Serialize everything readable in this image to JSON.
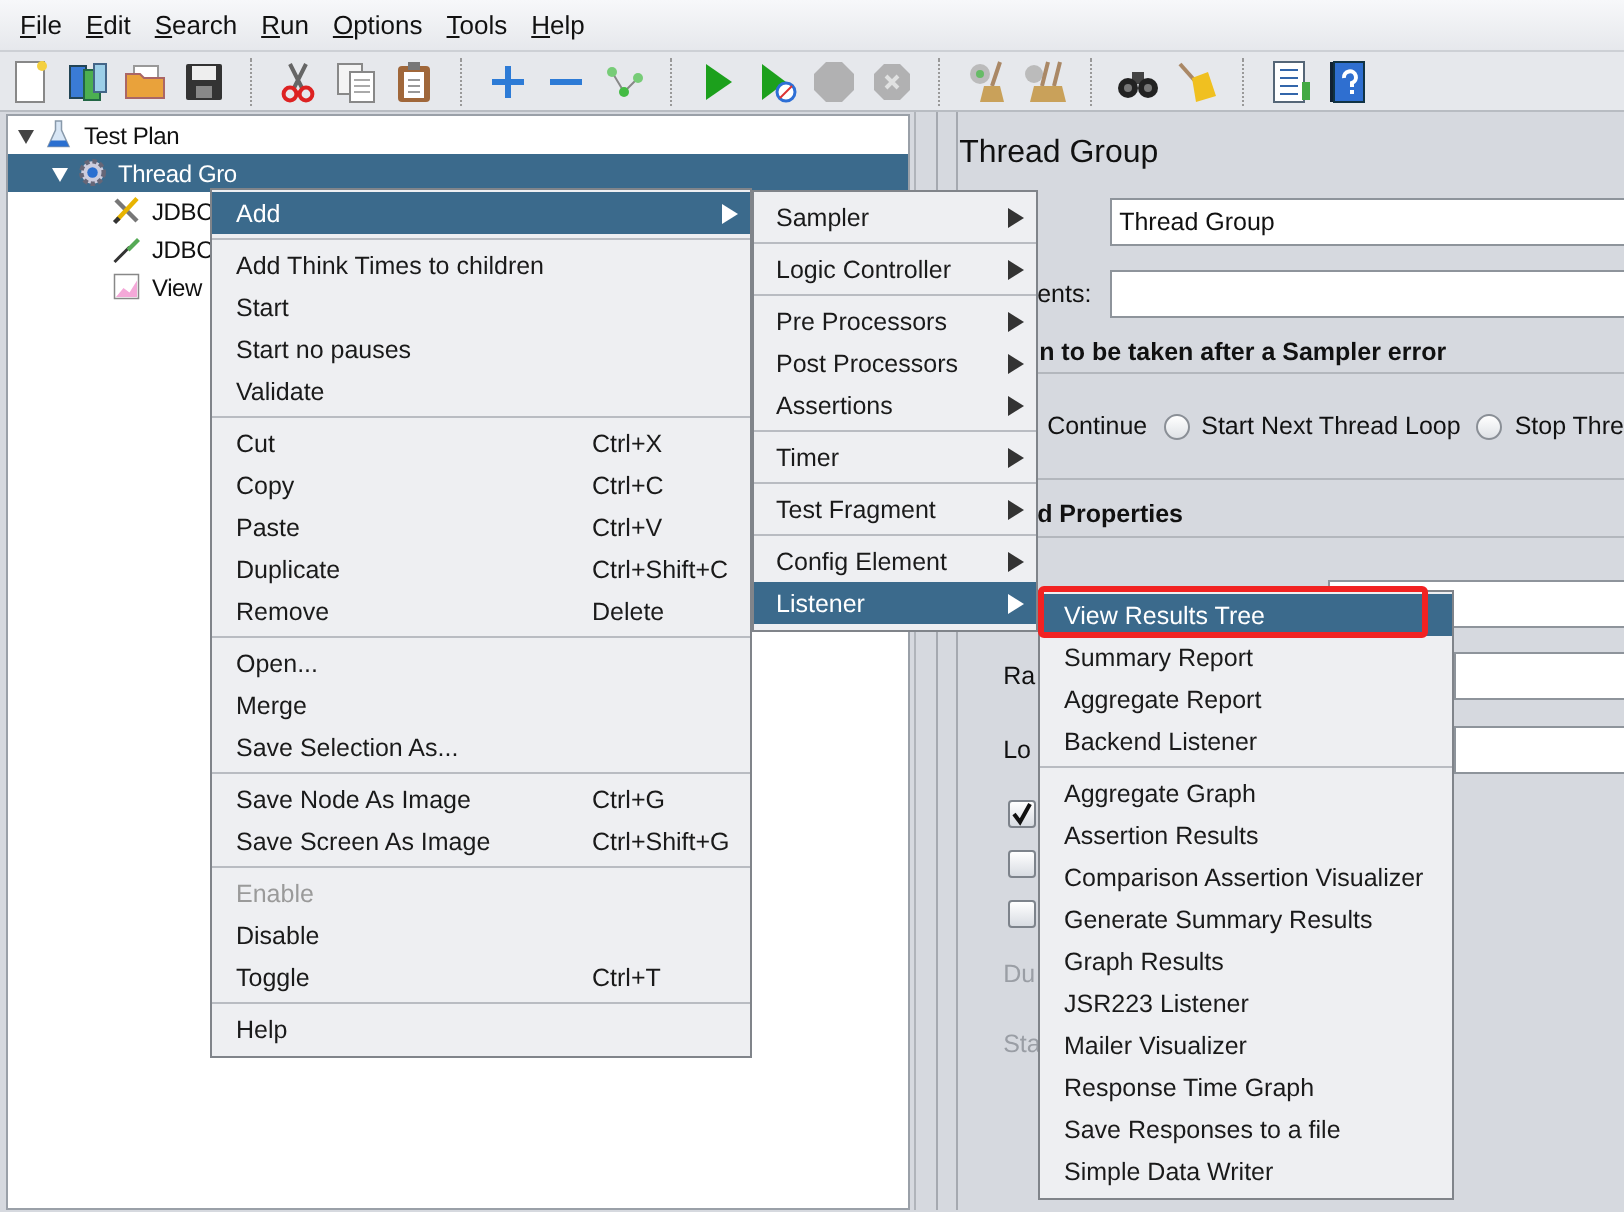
{
  "menu_bar": [
    "File",
    "Edit",
    "Search",
    "Run",
    "Options",
    "Tools",
    "Help"
  ],
  "toolbar": [
    {
      "kind": "new",
      "disabled": false
    },
    {
      "kind": "templates",
      "disabled": false
    },
    {
      "kind": "open",
      "disabled": false
    },
    {
      "kind": "save",
      "disabled": false
    },
    {
      "kind": "separator"
    },
    {
      "kind": "cut",
      "disabled": false
    },
    {
      "kind": "copy",
      "disabled": false
    },
    {
      "kind": "paste",
      "disabled": false
    },
    {
      "kind": "separator"
    },
    {
      "kind": "expand",
      "disabled": false
    },
    {
      "kind": "collapse",
      "disabled": false
    },
    {
      "kind": "toggle",
      "disabled": false
    },
    {
      "kind": "separator"
    },
    {
      "kind": "start",
      "disabled": false
    },
    {
      "kind": "start-no-pauses",
      "disabled": false
    },
    {
      "kind": "stop",
      "disabled": true
    },
    {
      "kind": "shutdown",
      "disabled": true
    },
    {
      "kind": "separator"
    },
    {
      "kind": "clear",
      "disabled": false
    },
    {
      "kind": "clear-all",
      "disabled": false
    },
    {
      "kind": "separator"
    },
    {
      "kind": "search",
      "disabled": false
    },
    {
      "kind": "reset-search",
      "disabled": false
    },
    {
      "kind": "separator"
    },
    {
      "kind": "function-helper",
      "disabled": false
    },
    {
      "kind": "help",
      "disabled": false
    }
  ],
  "tree": [
    {
      "label": "Test Plan",
      "kind": "test-plan",
      "expanded": true,
      "selected": false,
      "children": [
        {
          "label": "Thread Gro",
          "kind": "thread-group",
          "expanded": true,
          "selected": true,
          "children": [
            {
              "label": "JDBC",
              "kind": "config",
              "selected": false
            },
            {
              "label": "JDBC",
              "kind": "sampler",
              "selected": false
            },
            {
              "label": "View",
              "kind": "listener",
              "selected": false
            }
          ]
        }
      ]
    }
  ],
  "context_menu": {
    "items": [
      {
        "kind": "item",
        "label": "Add",
        "submenu": true,
        "selected": true,
        "disabled": false
      },
      {
        "kind": "separator"
      },
      {
        "kind": "item",
        "label": "Add Think Times to children",
        "submenu": false,
        "selected": false,
        "disabled": false
      },
      {
        "kind": "item",
        "label": "Start",
        "submenu": false,
        "selected": false,
        "disabled": false
      },
      {
        "kind": "item",
        "label": "Start no pauses",
        "submenu": false,
        "selected": false,
        "disabled": false
      },
      {
        "kind": "item",
        "label": "Validate",
        "submenu": false,
        "selected": false,
        "disabled": false
      },
      {
        "kind": "separator"
      },
      {
        "kind": "item",
        "label": "Cut",
        "shortcut": "Ctrl+X",
        "submenu": false,
        "selected": false,
        "disabled": false
      },
      {
        "kind": "item",
        "label": "Copy",
        "shortcut": "Ctrl+C",
        "submenu": false,
        "selected": false,
        "disabled": false
      },
      {
        "kind": "item",
        "label": "Paste",
        "shortcut": "Ctrl+V",
        "submenu": false,
        "selected": false,
        "disabled": false
      },
      {
        "kind": "item",
        "label": "Duplicate",
        "shortcut": "Ctrl+Shift+C",
        "submenu": false,
        "selected": false,
        "disabled": false
      },
      {
        "kind": "item",
        "label": "Remove",
        "shortcut": "Delete",
        "submenu": false,
        "selected": false,
        "disabled": false
      },
      {
        "kind": "separator"
      },
      {
        "kind": "item",
        "label": "Open...",
        "submenu": false,
        "selected": false,
        "disabled": false
      },
      {
        "kind": "item",
        "label": "Merge",
        "submenu": false,
        "selected": false,
        "disabled": false
      },
      {
        "kind": "item",
        "label": "Save Selection As...",
        "submenu": false,
        "selected": false,
        "disabled": false
      },
      {
        "kind": "separator"
      },
      {
        "kind": "item",
        "label": "Save Node As Image",
        "shortcut": "Ctrl+G",
        "submenu": false,
        "selected": false,
        "disabled": false
      },
      {
        "kind": "item",
        "label": "Save Screen As Image",
        "shortcut": "Ctrl+Shift+G",
        "submenu": false,
        "selected": false,
        "disabled": false
      },
      {
        "kind": "separator"
      },
      {
        "kind": "item",
        "label": "Enable",
        "submenu": false,
        "selected": false,
        "disabled": true
      },
      {
        "kind": "item",
        "label": "Disable",
        "submenu": false,
        "selected": false,
        "disabled": false
      },
      {
        "kind": "item",
        "label": "Toggle",
        "shortcut": "Ctrl+T",
        "submenu": false,
        "selected": false,
        "disabled": false
      },
      {
        "kind": "separator"
      },
      {
        "kind": "item",
        "label": "Help",
        "submenu": false,
        "selected": false,
        "disabled": false
      }
    ]
  },
  "add_submenu": {
    "items": [
      {
        "kind": "item",
        "label": "Sampler",
        "submenu": true,
        "selected": false,
        "disabled": false
      },
      {
        "kind": "separator"
      },
      {
        "kind": "item",
        "label": "Logic Controller",
        "submenu": true,
        "selected": false,
        "disabled": false
      },
      {
        "kind": "separator"
      },
      {
        "kind": "item",
        "label": "Pre Processors",
        "submenu": true,
        "selected": false,
        "disabled": false
      },
      {
        "kind": "item",
        "label": "Post Processors",
        "submenu": true,
        "selected": false,
        "disabled": false
      },
      {
        "kind": "item",
        "label": "Assertions",
        "submenu": true,
        "selected": false,
        "disabled": false
      },
      {
        "kind": "separator"
      },
      {
        "kind": "item",
        "label": "Timer",
        "submenu": true,
        "selected": false,
        "disabled": false
      },
      {
        "kind": "separator"
      },
      {
        "kind": "item",
        "label": "Test Fragment",
        "submenu": true,
        "selected": false,
        "disabled": false
      },
      {
        "kind": "separator"
      },
      {
        "kind": "item",
        "label": "Config Element",
        "submenu": true,
        "selected": false,
        "disabled": false
      },
      {
        "kind": "item",
        "label": "Listener",
        "submenu": true,
        "selected": true,
        "disabled": false
      }
    ]
  },
  "listener_submenu": {
    "items": [
      {
        "kind": "item",
        "label": "View Results Tree",
        "submenu": false,
        "selected": true,
        "disabled": false
      },
      {
        "kind": "item",
        "label": "Summary Report",
        "submenu": false,
        "selected": false,
        "disabled": false
      },
      {
        "kind": "item",
        "label": "Aggregate Report",
        "submenu": false,
        "selected": false,
        "disabled": false
      },
      {
        "kind": "item",
        "label": "Backend Listener",
        "submenu": false,
        "selected": false,
        "disabled": false
      },
      {
        "kind": "separator"
      },
      {
        "kind": "item",
        "label": "Aggregate Graph",
        "submenu": false,
        "selected": false,
        "disabled": false
      },
      {
        "kind": "item",
        "label": "Assertion Results",
        "submenu": false,
        "selected": false,
        "disabled": false
      },
      {
        "kind": "item",
        "label": "Comparison Assertion Visualizer",
        "submenu": false,
        "selected": false,
        "disabled": false
      },
      {
        "kind": "item",
        "label": "Generate Summary Results",
        "submenu": false,
        "selected": false,
        "disabled": false
      },
      {
        "kind": "item",
        "label": "Graph Results",
        "submenu": false,
        "selected": false,
        "disabled": false
      },
      {
        "kind": "item",
        "label": "JSR223 Listener",
        "submenu": false,
        "selected": false,
        "disabled": false
      },
      {
        "kind": "item",
        "label": "Mailer Visualizer",
        "submenu": false,
        "selected": false,
        "disabled": false
      },
      {
        "kind": "item",
        "label": "Response Time Graph",
        "submenu": false,
        "selected": false,
        "disabled": false
      },
      {
        "kind": "item",
        "label": "Save Responses to a file",
        "submenu": false,
        "selected": false,
        "disabled": false
      },
      {
        "kind": "item",
        "label": "Simple Data Writer",
        "submenu": false,
        "selected": false,
        "disabled": false
      }
    ]
  },
  "properties": {
    "title": "Thread Group",
    "name_value": "Thread Group",
    "comments_label": "ents:",
    "error_action": {
      "heading": "n to be taken after a Sampler error",
      "first_label": "Continue",
      "options": [
        {
          "label": "Start Next Thread Loop",
          "selected": false
        },
        {
          "label": "Stop Thre",
          "selected": false
        }
      ]
    },
    "thread_properties": {
      "heading": "d Properties",
      "rows": [
        {
          "kind": "field"
        },
        {
          "kind": "field",
          "label": "Ra"
        },
        {
          "kind": "field",
          "label": "Lo"
        },
        {
          "kind": "checkbox",
          "checked": true
        },
        {
          "kind": "checkbox",
          "checked": false
        },
        {
          "kind": "checkbox",
          "checked": false
        },
        {
          "kind": "label",
          "label": "Du",
          "disabled": true
        },
        {
          "kind": "label",
          "label": "Sta",
          "disabled": true
        }
      ]
    }
  }
}
